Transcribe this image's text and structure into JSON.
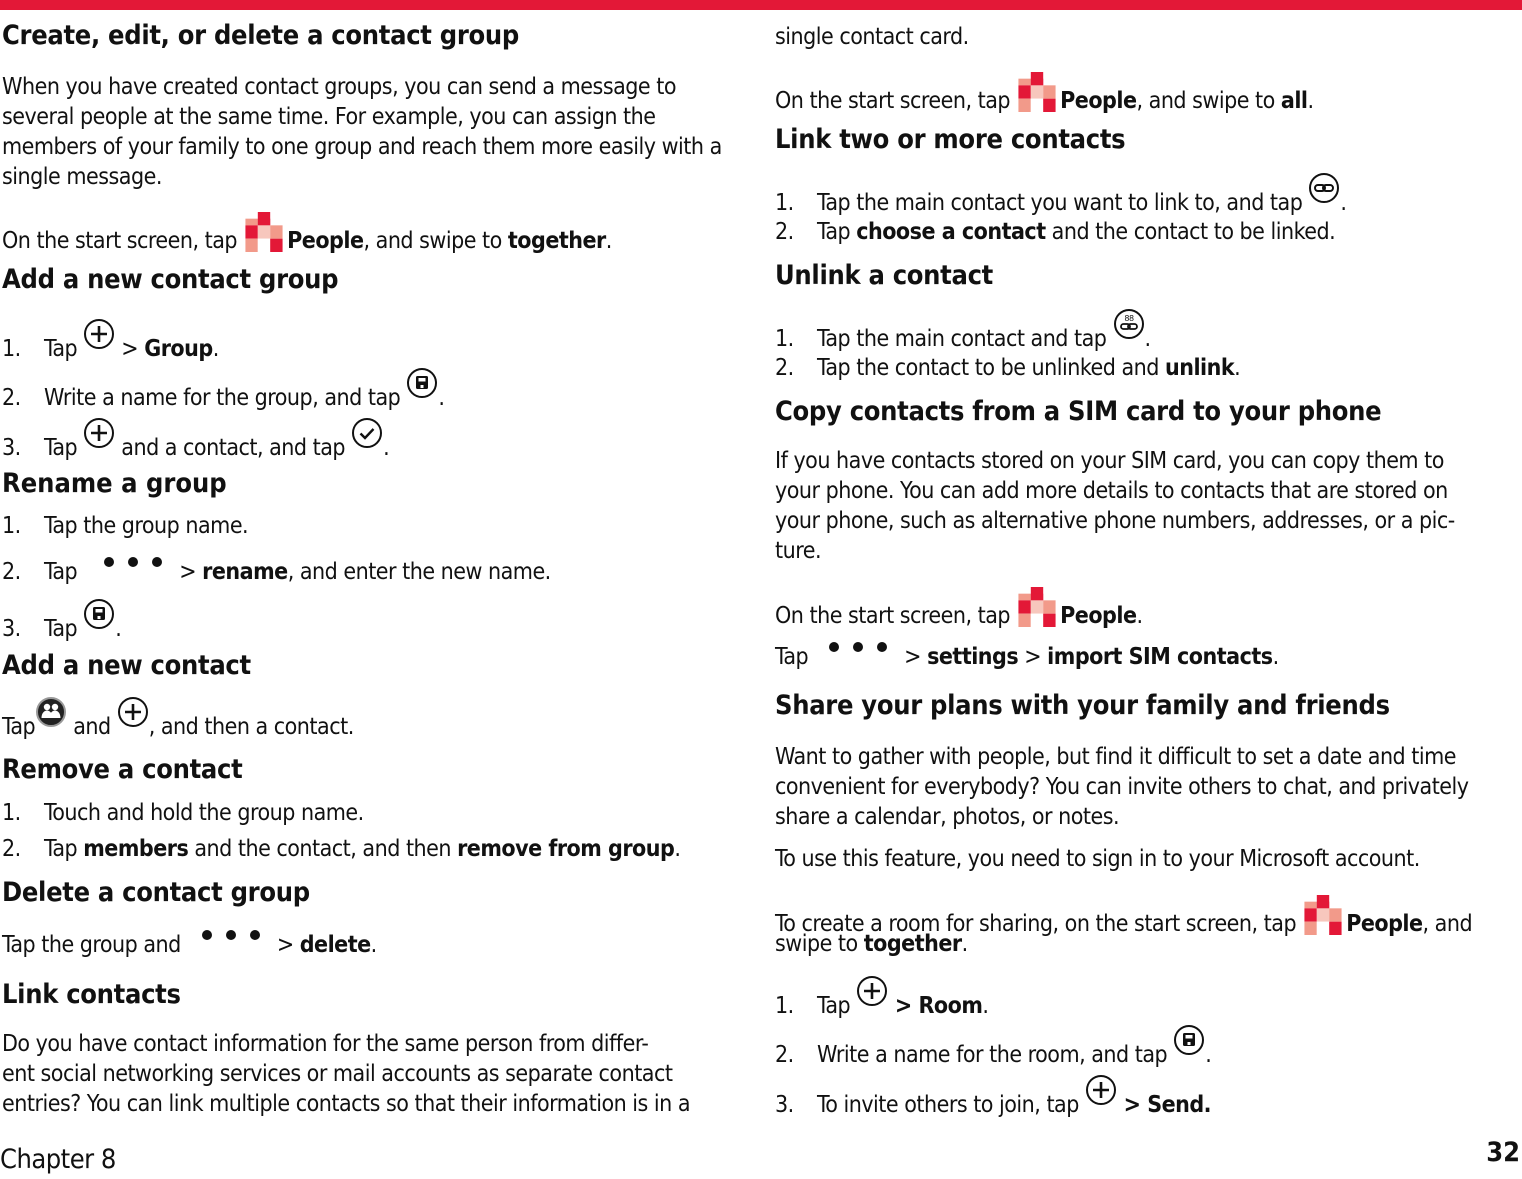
{
  "colors": {
    "accent": "#E31837",
    "people_tile_light": "#F29A8A",
    "people_tile_pale": "#F7C7BD"
  },
  "icons": {
    "add": "plus-circle-icon",
    "save": "save-icon",
    "check": "check-circle-icon",
    "more": "more-dots-icon",
    "people_tile": "people-tile-icon",
    "me": "me-people-icon",
    "link": "link-icon",
    "unlink": "linked-contacts-icon"
  },
  "left": {
    "create": {
      "title": "Create, edit, or delete a contact group",
      "intro": "When you have created contact groups, you can send a message to several people at the same time. For example, you can assign the members of your family to one group and reach them more easily with a single message.",
      "start_pre": "On the start screen, tap",
      "start_app": "People",
      "start_mid": ", and swipe to",
      "start_target": "together",
      "start_end": "."
    },
    "add_group": {
      "title": "Add a new contact group",
      "steps": [
        {
          "num": "1.",
          "pre": "Tap",
          "mid": " > ",
          "bold": "Group",
          "end": "."
        },
        {
          "num": "2.",
          "pre": "Write a name for the group, and tap",
          "end": "."
        },
        {
          "num": "3.",
          "pre": "Tap",
          "mid": " and a contact, and tap",
          "end": "."
        }
      ]
    },
    "rename": {
      "title": "Rename a group",
      "steps": [
        {
          "num": "1.",
          "text": "Tap the group name."
        },
        {
          "num": "2.",
          "pre": "Tap",
          "mid": "> ",
          "bold": "rename",
          "end": ", and enter the new name."
        },
        {
          "num": "3.",
          "pre": "Tap",
          "end": "."
        }
      ]
    },
    "add_contact": {
      "title": "Add a new contact",
      "pre": "Tap",
      "mid": " and ",
      "end": ", and then a contact."
    },
    "remove": {
      "title": "Remove a contact",
      "steps": [
        {
          "num": "1.",
          "text": "Touch and hold the group name."
        },
        {
          "num": "2.",
          "pre": "Tap ",
          "bold1": "members",
          "mid": " and the contact, and then ",
          "bold2": "remove from group",
          "end": "."
        }
      ]
    },
    "delete": {
      "title": "Delete a contact group",
      "pre": "Tap the group and",
      "mid": "> ",
      "bold": "delete",
      "end": "."
    },
    "link": {
      "title": "Link contacts",
      "body_lines": [
        "Do you have contact information for the same person from differ-",
        "ent social networking services or mail accounts as separate contact",
        "entries? You can link multiple contacts so that their information is in a"
      ]
    }
  },
  "right": {
    "link_cont": {
      "line": "single contact card.",
      "start_pre": "On the start screen, tap",
      "start_app": "People",
      "start_mid": ", and swipe to ",
      "start_target": "all",
      "start_end": "."
    },
    "link_two": {
      "title": "Link two or more contacts",
      "steps": [
        {
          "num": "1.",
          "pre": "Tap the main contact you want to link to, and tap",
          "end": "."
        },
        {
          "num": "2.",
          "pre": "Tap ",
          "bold": "choose a contact",
          "end": " and the contact to be linked."
        }
      ]
    },
    "unlink": {
      "title": "Unlink a contact",
      "steps": [
        {
          "num": "1.",
          "pre": "Tap the main contact and tap",
          "end": "."
        },
        {
          "num": "2.",
          "pre": "Tap the contact to be unlinked and ",
          "bold": "unlink",
          "end": "."
        }
      ]
    },
    "sim": {
      "title": "Copy contacts from a SIM card to your phone",
      "body_lines": [
        "If you have contacts stored on your SIM card, you can copy them to",
        "your phone. You can add more details to contacts that are stored on",
        "your phone, such as alternative phone numbers, addresses, or a pic-",
        "ture."
      ],
      "start_pre": "On the start screen, tap",
      "start_app": "People",
      "start_end": ".",
      "tap_pre": "Tap",
      "tap_mid1": "> ",
      "tap_bold1": "settings",
      "tap_mid2": " > ",
      "tap_bold2": "import SIM contacts",
      "tap_end": "."
    },
    "share": {
      "title": "Share your plans with your family and friends",
      "body_lines": [
        "Want to gather with people, but find it difficult to set a date and time",
        "convenient for everybody? You can invite others to chat, and privately",
        "share a calendar, photos, or notes."
      ],
      "signin": "To use this feature, you need to sign in to your Microsoft account.",
      "room_pre": "To create a room for sharing, on the start screen, tap",
      "room_app": "People",
      "room_mid": ", and",
      "room_line2_pre": "swipe to ",
      "room_target": "together",
      "room_end": ".",
      "steps": [
        {
          "num": "1.",
          "pre": "Tap",
          "bold": " > Room",
          "end": "."
        },
        {
          "num": "2.",
          "pre": "Write a name for the room, and tap",
          "end": "."
        },
        {
          "num": "3.",
          "pre": "To invite others to join, tap",
          "bold": " > Send.",
          "end": ""
        }
      ]
    }
  },
  "footer": {
    "chapter": "Chapter 8",
    "page": "32"
  }
}
